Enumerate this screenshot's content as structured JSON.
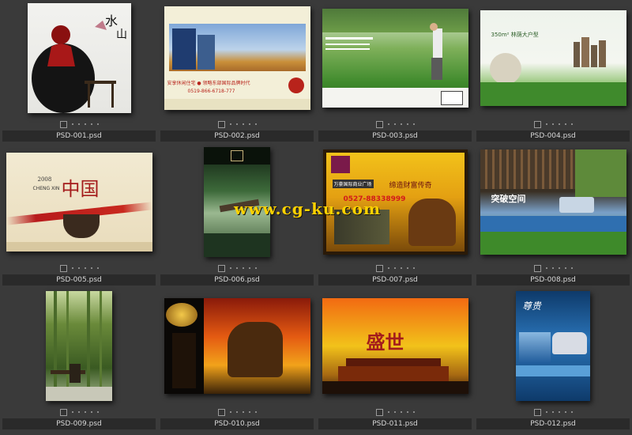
{
  "files": [
    {
      "name": "PSD-001.psd"
    },
    {
      "name": "PSD-002.psd",
      "title": "安享休闲住宅 ● 领略东部国际品牌时代",
      "phone": "0519-866-6718-777"
    },
    {
      "name": "PSD-003.psd"
    },
    {
      "name": "PSD-004.psd",
      "headline": "350m² 林荫大户型"
    },
    {
      "name": "PSD-005.psd",
      "year": "2008",
      "brand": "CHENG XIN",
      "big": "中国"
    },
    {
      "name": "PSD-006.psd"
    },
    {
      "name": "PSD-007.psd",
      "banner": "万豪国际商业广场",
      "slogan": "缔造财富传奇",
      "phone": "0527-88338999"
    },
    {
      "name": "PSD-008.psd",
      "title": "突破空间"
    },
    {
      "name": "PSD-009.psd"
    },
    {
      "name": "PSD-010.psd"
    },
    {
      "name": "PSD-011.psd",
      "title": "盛世"
    },
    {
      "name": "PSD-012.psd",
      "title": "尊贵"
    }
  ],
  "watermark": "www.cg-ku.com",
  "colors": {
    "background": "#3a3a3a",
    "caption_bg": "#2a2a2a",
    "caption_text": "#d8d8d8",
    "watermark": "#ffd200"
  }
}
